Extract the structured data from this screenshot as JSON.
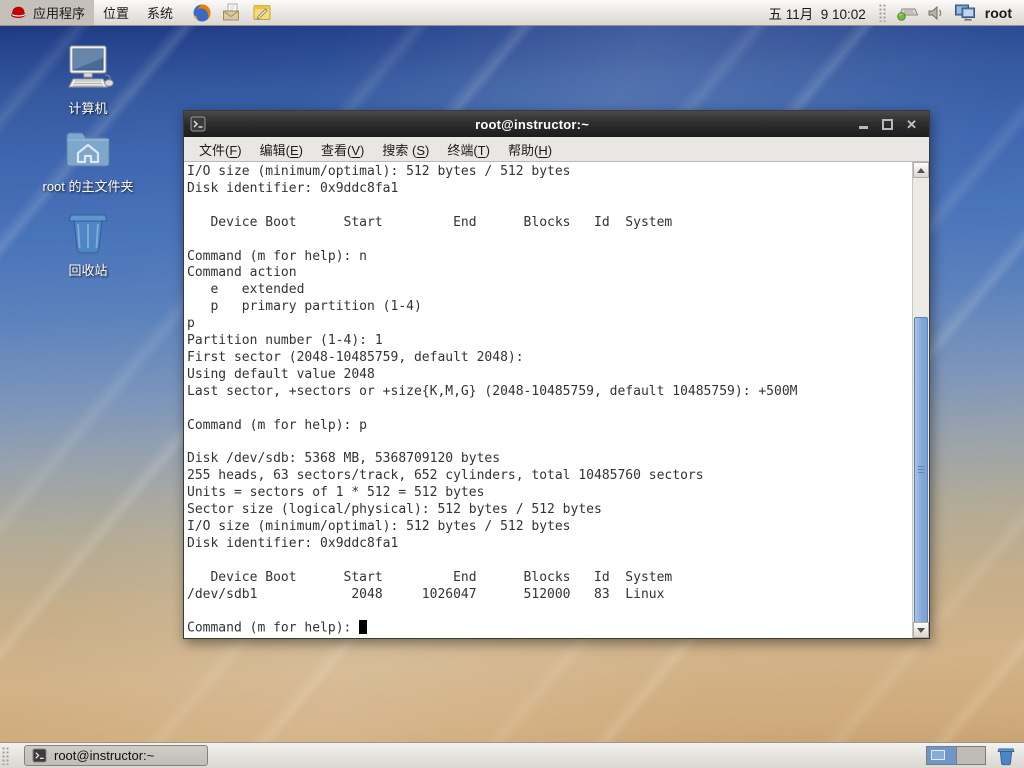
{
  "top_panel": {
    "menus": [
      {
        "label": "应用程序"
      },
      {
        "label": "位置"
      },
      {
        "label": "系统"
      }
    ],
    "clock": "五 11月  9 10:02",
    "username": "root"
  },
  "desktop": {
    "icons": [
      {
        "label": "计算机"
      },
      {
        "label": "root 的主文件夹"
      },
      {
        "label": "回收站"
      }
    ]
  },
  "terminal": {
    "title": "root@instructor:~",
    "close_glyph": "✕",
    "menu": [
      {
        "pre": "文件(",
        "key": "F",
        "post": ")"
      },
      {
        "pre": "编辑(",
        "key": "E",
        "post": ")"
      },
      {
        "pre": "查看(",
        "key": "V",
        "post": ")"
      },
      {
        "pre": "搜索 (",
        "key": "S",
        "post": ")"
      },
      {
        "pre": "终端(",
        "key": "T",
        "post": ")"
      },
      {
        "pre": "帮助(",
        "key": "H",
        "post": ")"
      }
    ],
    "output": "I/O size (minimum/optimal): 512 bytes / 512 bytes\nDisk identifier: 0x9ddc8fa1\n\n   Device Boot      Start         End      Blocks   Id  System\n\nCommand (m for help): n\nCommand action\n   e   extended\n   p   primary partition (1-4)\np\nPartition number (1-4): 1\nFirst sector (2048-10485759, default 2048): \nUsing default value 2048\nLast sector, +sectors or +size{K,M,G} (2048-10485759, default 10485759): +500M\n\nCommand (m for help): p\n\nDisk /dev/sdb: 5368 MB, 5368709120 bytes\n255 heads, 63 sectors/track, 652 cylinders, total 10485760 sectors\nUnits = sectors of 1 * 512 = 512 bytes\nSector size (logical/physical): 512 bytes / 512 bytes\nI/O size (minimum/optimal): 512 bytes / 512 bytes\nDisk identifier: 0x9ddc8fa1\n\n   Device Boot      Start         End      Blocks   Id  System\n/dev/sdb1            2048     1026047      512000   83  Linux\n\nCommand (m for help): "
  },
  "taskbar": {
    "task_label": "root@instructor:~"
  },
  "colors": {
    "titlebar_bg": "#2e2e2e",
    "terminal_bg": "#ffffff",
    "terminal_fg": "#333333",
    "scroll_thumb": "#84a9d9",
    "panel_bg": "#dcd8d1",
    "wallpaper_top": "#16255c",
    "wallpaper_bottom": "#c39c6d",
    "workspace_active": "#6e96ca",
    "redhat_red": "#cc0000"
  }
}
